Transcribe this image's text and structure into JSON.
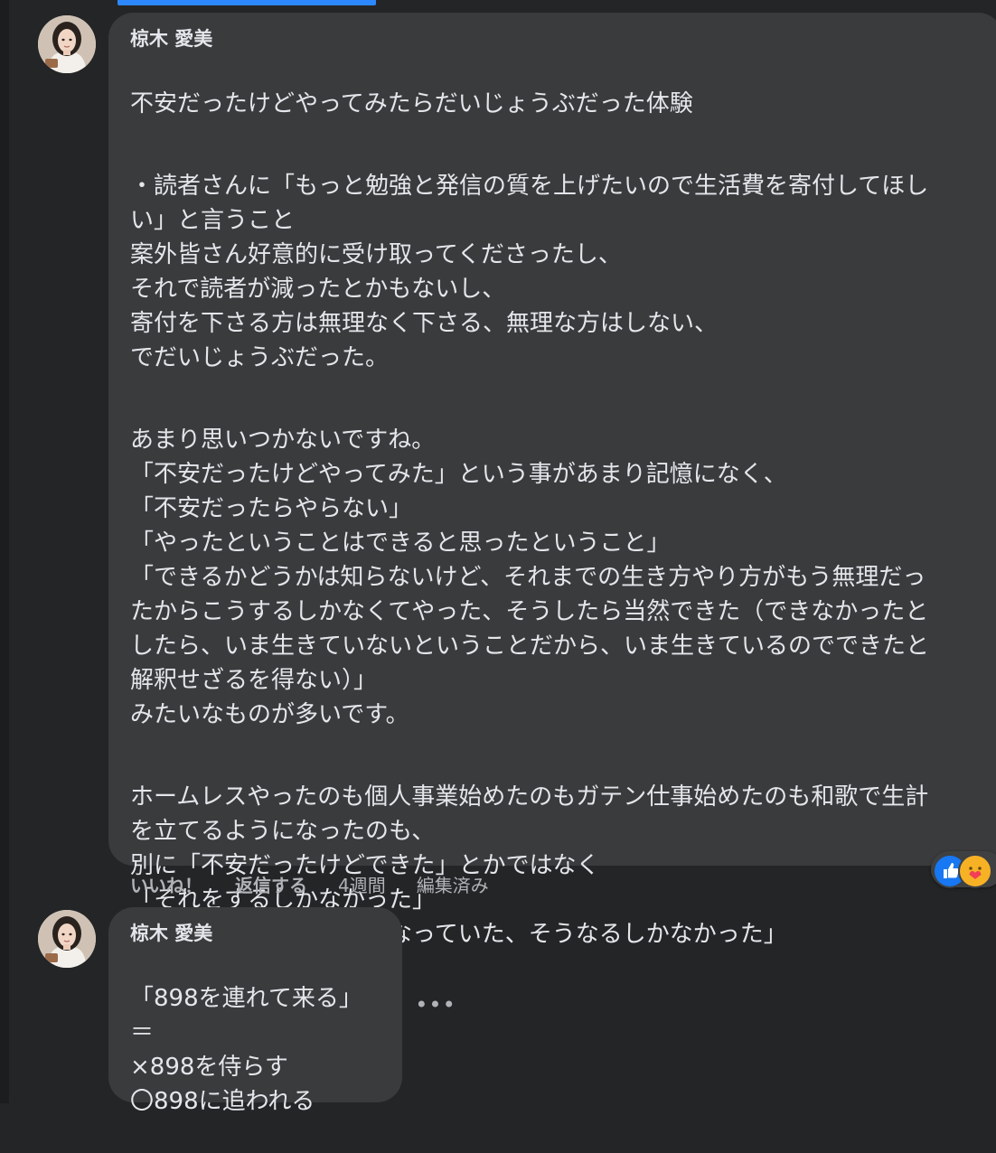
{
  "comments": [
    {
      "author": "椋木 愛美",
      "paragraphs": [
        "不安だったけどやってみたらだいじょうぶだった体験",
        "・読者さんに「もっと勉強と発信の質を上げたいので生活費を寄付してほし\nい」と言うこと\n案外皆さん好意的に受け取ってくださったし、\nそれで読者が減ったとかもないし、\n寄付を下さる方は無理なく下さる、無理な方はしない、\nでだいじょうぶだった。",
        "あまり思いつかないですね。\n「不安だったけどやってみた」という事があまり記憶になく、\n「不安だったらやらない」\n「やったということはできると思ったということ」\n「できるかどうかは知らないけど、それまでの生き方やり方がもう無理だっ\nたからこうするしかなくてやった、そうしたら当然できた（できなかったと\nしたら、いま生きていないということだから、いま生きているのでできたと\n解釈せざるを得ない）」\nみたいなものが多いです。",
        "ホームレスやったのも個人事業始めたのもガテン仕事始めたのも和歌で生計\nを立てるようになったのも、\n別に「不安だったけどできた」とかではなく\n「それをするしかなかった」\nまたは「気づいたらそうなっていた、そうなるしかなかった」\nという気がするなあ。"
      ],
      "actions": {
        "like": "いいね！",
        "reply": "返信する",
        "time": "4週間",
        "edited": "編集済み"
      },
      "reactions": [
        "like-icon",
        "care-icon"
      ]
    },
    {
      "author": "椋木 愛美",
      "paragraphs": [
        "「898を連れて来る」\n＝\n×898を侍らす\n〇898に追われる"
      ],
      "more_label": "•••"
    }
  ],
  "colors": {
    "background": "#242526",
    "bubble": "#3a3b3c",
    "text": "#e4e6eb",
    "secondary_text": "#b0b3b8",
    "like_blue": "#1877f2",
    "care_yellow": "#f7b125",
    "active_tab": "#2d88ff"
  }
}
